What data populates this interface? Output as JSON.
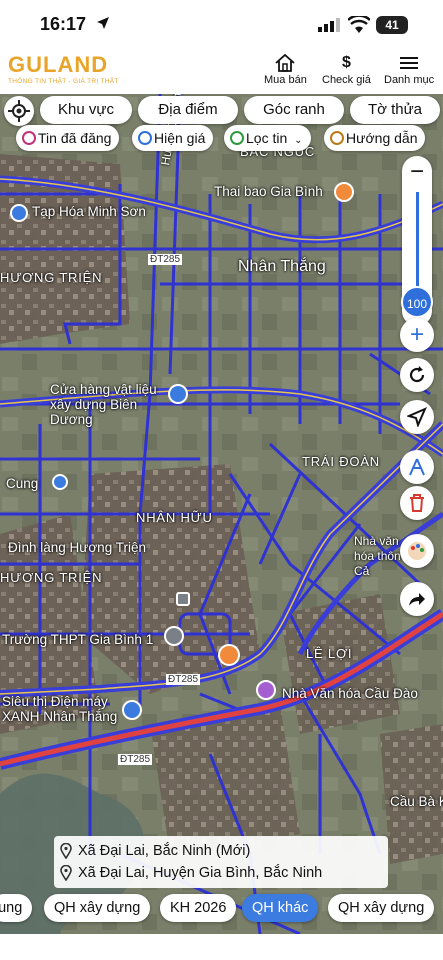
{
  "status": {
    "time": "16:17",
    "battery": "41"
  },
  "header": {
    "brand": "GULAND",
    "tagline": "THÔNG TIN THẬT - GIÁ TRỊ THẬT",
    "nav": [
      {
        "label": "Mua bán",
        "icon": "house-icon"
      },
      {
        "label": "Check giá",
        "icon": "dollar-icon"
      },
      {
        "label": "Danh mục",
        "icon": "menu-icon"
      }
    ]
  },
  "filters": {
    "primary": [
      "Khu vực",
      "Địa điểm",
      "Góc ranh",
      "Tờ thửa"
    ],
    "secondary": [
      "Tin đã đăng",
      "Hiện giá",
      "Lọc tin",
      "Hướng dẫn"
    ]
  },
  "map": {
    "zoom": "100",
    "labels": [
      "Tạp Hóa Minh Sơn",
      "Thai bao Gia Bình",
      "BẮC NGÚC",
      "Huyện Quỳnh",
      "ĐT285",
      "Nhân Thắng",
      "HƯƠNG TRIỆN",
      "Cửa hàng vật liệu xây dựng Biên Dương",
      "TRÁI ĐOÀN",
      "Cung",
      "NHÂN HỮU",
      "Đình làng Hương Triện",
      "HƯƠNG TRIỆN",
      "Nhà văn hóa thôn Cả",
      "Trường THPT Gia Bình 1",
      "LÊ LỢI",
      "ĐT285",
      "Siêu thị Điện máy XANH Nhân Thắng",
      "Nhà Văn hóa Cầu Đào",
      "ĐT285",
      "Cầu Bà K"
    ]
  },
  "address": {
    "line1": "Xã Đại Lai, Bắc Ninh (Mới)",
    "line2": "Xã Đại Lai, Huyện Gia Bình, Bắc Ninh"
  },
  "tabs": [
    "hung",
    "QH xây dựng",
    "KH 2026",
    "QH khác",
    "QH xây dựng"
  ],
  "active_tab": "QH khác"
}
